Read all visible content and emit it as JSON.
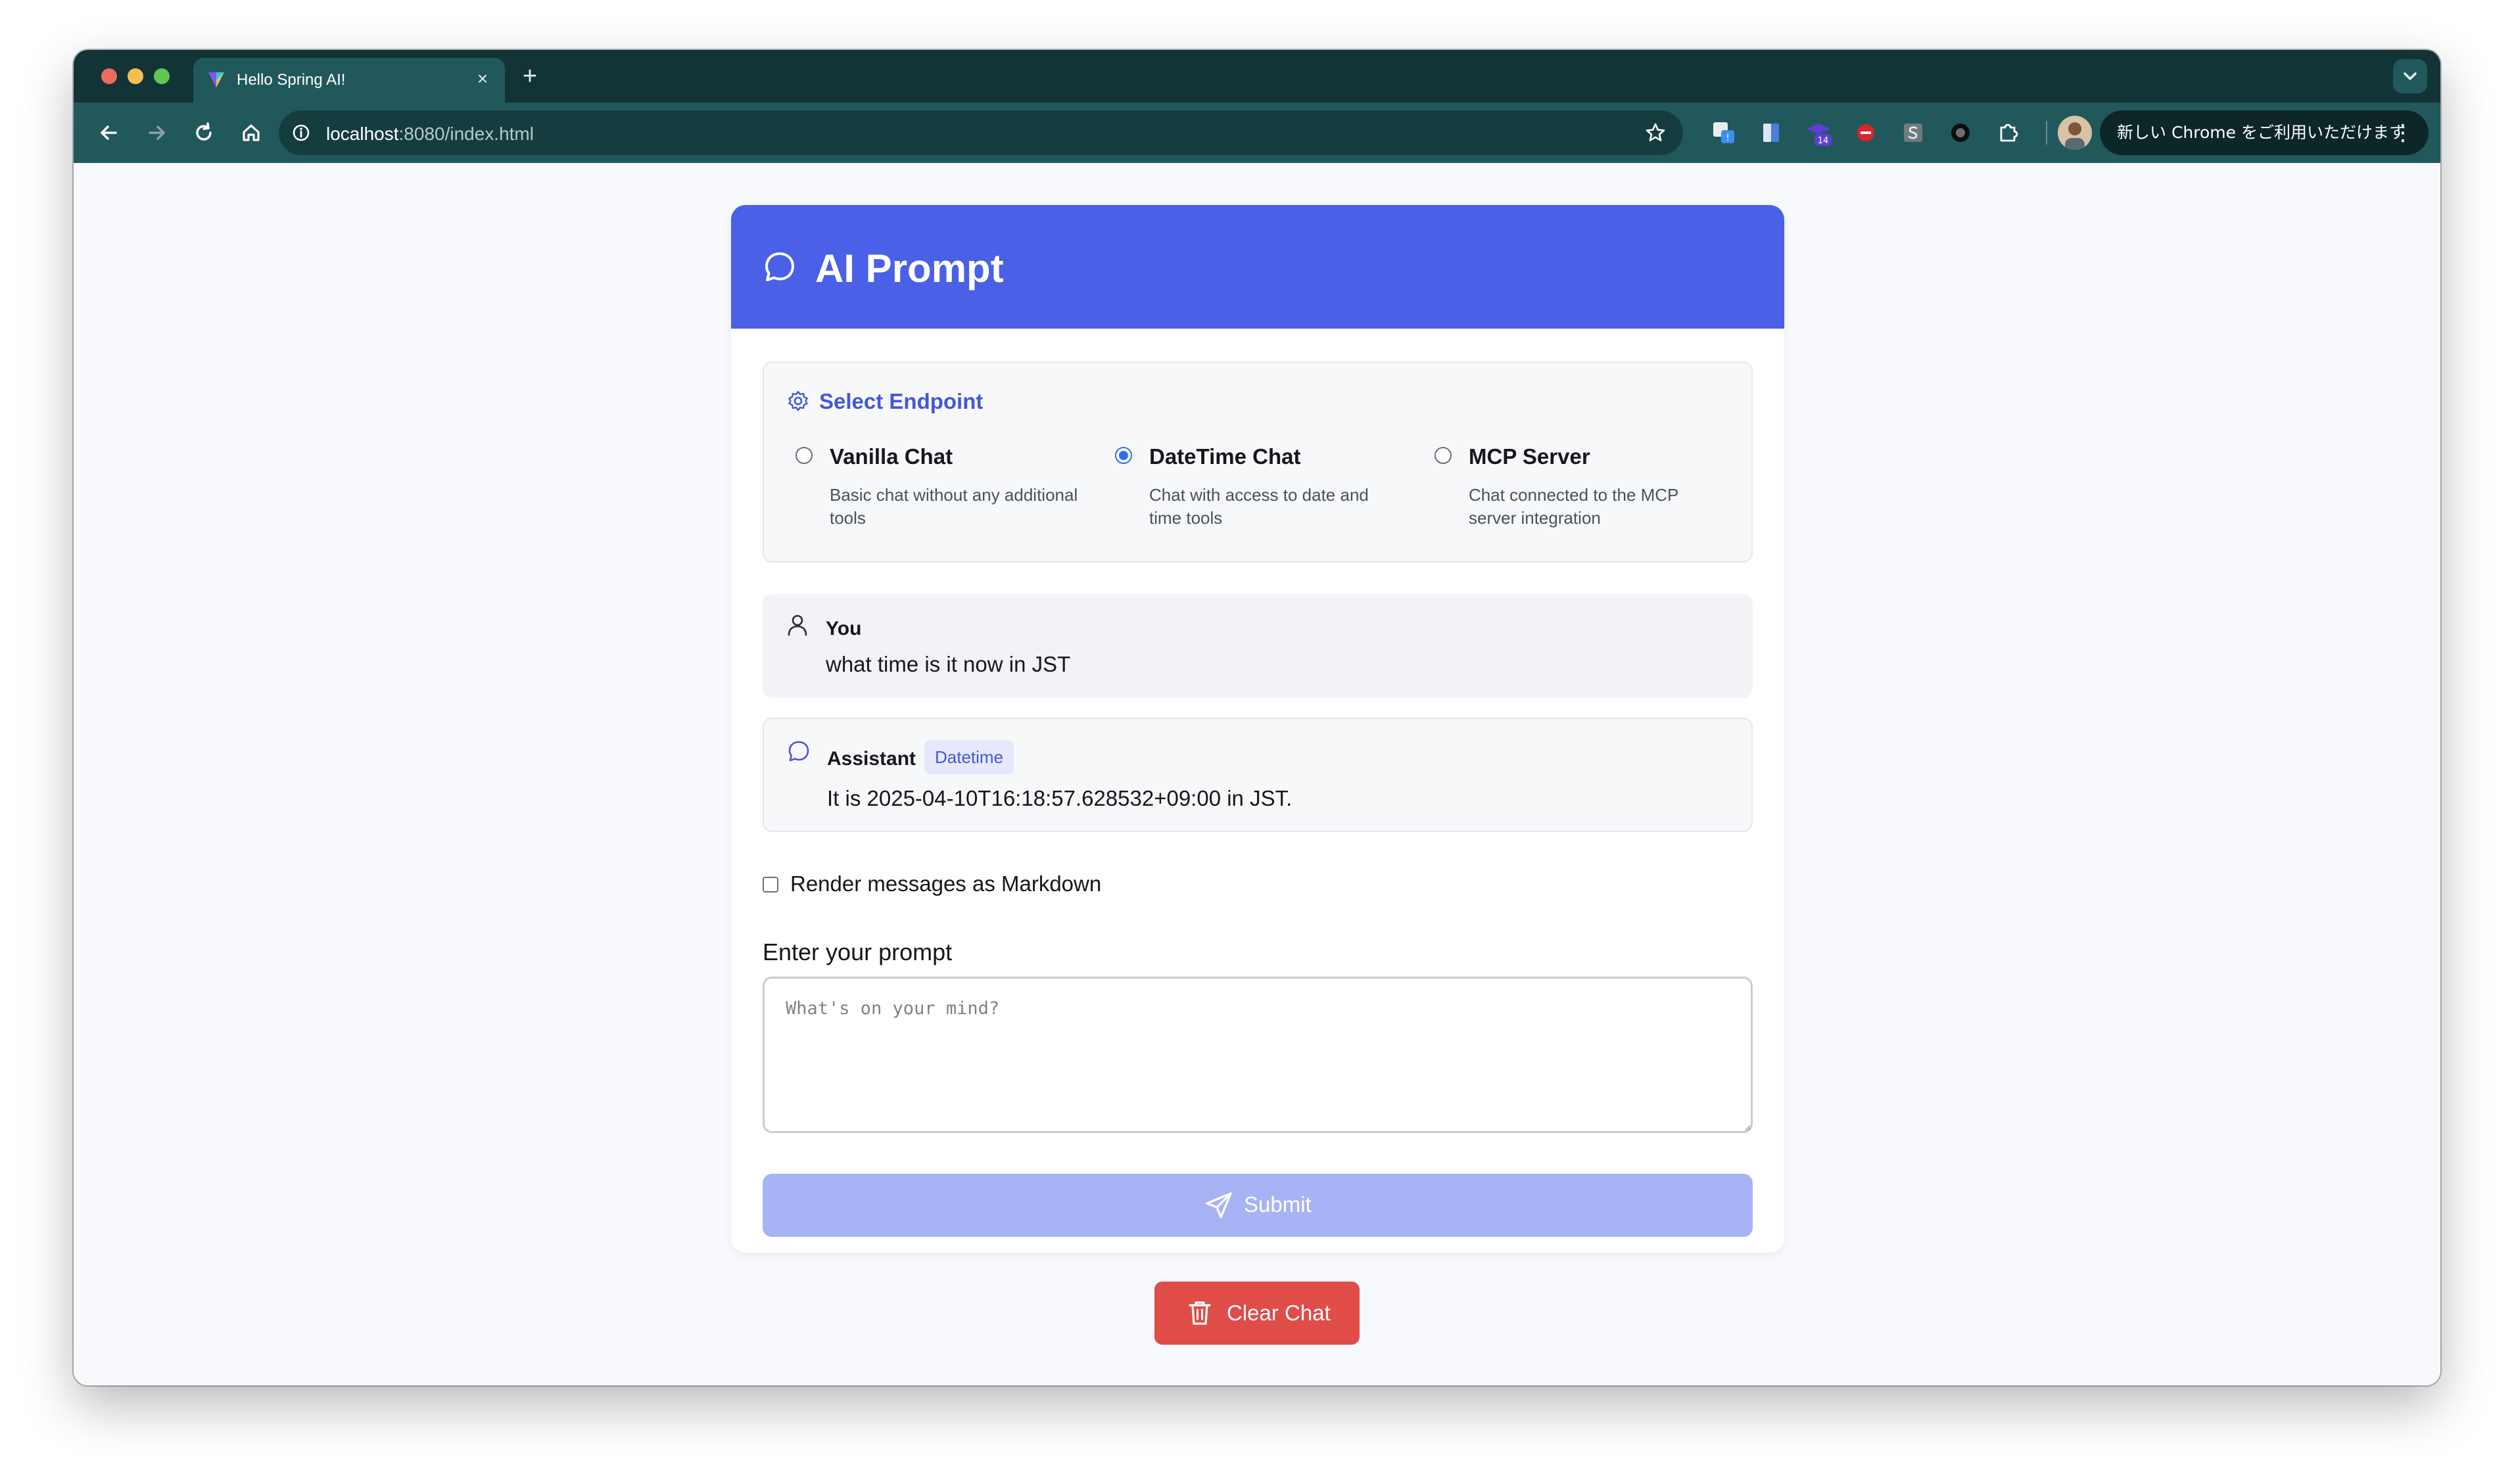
{
  "browser": {
    "tab_title": "Hello Spring AI!",
    "tab_close": "×",
    "new_tab": "+",
    "url_host": "localhost",
    "url_rest": ":8080/index.html",
    "extension_badge": "14",
    "update_text": "新しい Chrome をご利用いただけます",
    "menu_glyph": "⋮",
    "colors": {
      "tabbar": "#123436",
      "toolbar": "#21585c"
    }
  },
  "header": {
    "title": "AI Prompt",
    "icon": "chat-bubble-icon",
    "color": "#4a60e6"
  },
  "endpoint": {
    "heading": "Select Endpoint",
    "icon": "gear-icon",
    "selected": "DateTime Chat",
    "options": [
      {
        "title": "Vanilla Chat",
        "desc": "Basic chat without any additional tools",
        "checked": false
      },
      {
        "title": "DateTime Chat",
        "desc": "Chat with access to date and time tools",
        "checked": true
      },
      {
        "title": "MCP Server",
        "desc": "Chat connected to the MCP server integration",
        "checked": false
      }
    ]
  },
  "messages": [
    {
      "role": "You",
      "icon": "user-icon",
      "text": "what time is it now in JST"
    },
    {
      "role": "Assistant",
      "icon": "chat-bubble-icon",
      "badge": "Datetime",
      "text": "It is 2025-04-10T16:18:57.628532+09:00 in JST."
    }
  ],
  "markdown": {
    "label": "Render messages as Markdown",
    "checked": false
  },
  "prompt": {
    "label": "Enter your prompt",
    "placeholder": "What's on your mind?",
    "value": ""
  },
  "submit": {
    "label": "Submit",
    "icon": "send-icon",
    "color": "#a8b3f5"
  },
  "clear": {
    "label": "Clear Chat",
    "icon": "trash-icon",
    "color": "#e04c48"
  }
}
